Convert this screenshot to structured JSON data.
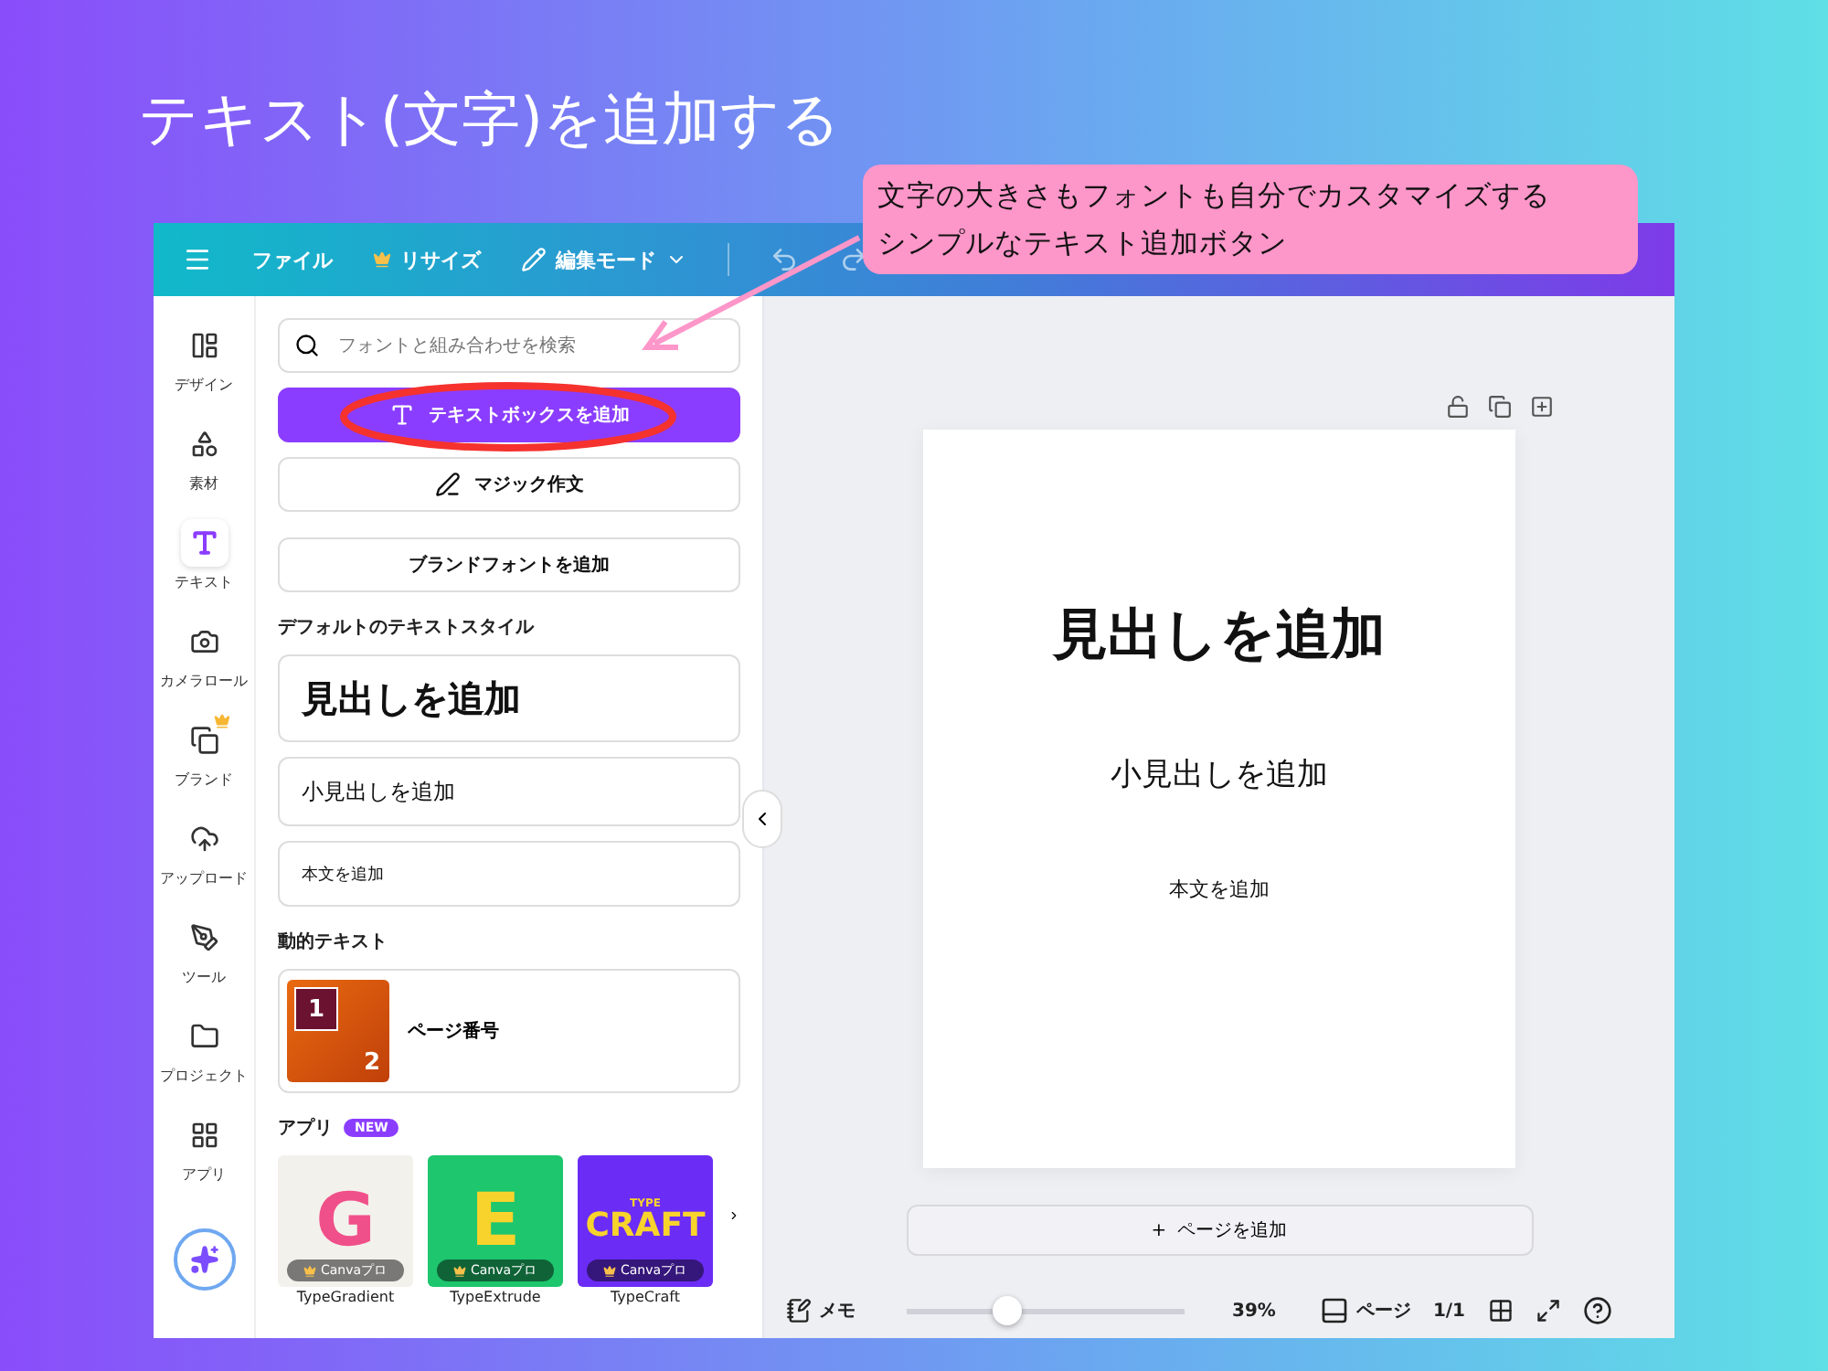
{
  "slide_title": "テキスト(文字)を追加する",
  "callout": {
    "lines": [
      "文字の大きさもフォントも自分でカスタマイズする",
      "シンプルなテキスト追加ボタン"
    ]
  },
  "topbar": {
    "menu": "ファイル",
    "resize": "リサイズ",
    "mode": "編集モード"
  },
  "sidebar": [
    {
      "kind": "design",
      "label": "デザイン",
      "selected": false,
      "premium": false
    },
    {
      "kind": "elements",
      "label": "素材",
      "selected": false,
      "premium": false
    },
    {
      "kind": "text",
      "label": "テキスト",
      "selected": true,
      "premium": false
    },
    {
      "kind": "camera",
      "label": "カメラロール",
      "selected": false,
      "premium": false
    },
    {
      "kind": "brand",
      "label": "ブランド",
      "selected": false,
      "premium": true
    },
    {
      "kind": "upload",
      "label": "アップロード",
      "selected": false,
      "premium": false
    },
    {
      "kind": "tools",
      "label": "ツール",
      "selected": false,
      "premium": false
    },
    {
      "kind": "projects",
      "label": "プロジェクト",
      "selected": false,
      "premium": false
    },
    {
      "kind": "apps",
      "label": "アプリ",
      "selected": false,
      "premium": false
    }
  ],
  "panel": {
    "search_placeholder": "フォントと組み合わせを検索",
    "add_textbox": "テキストボックスを追加",
    "magic_write": "マジック作文",
    "brand_fonts": "ブランドフォントを追加",
    "default_styles_heading": "デフォルトのテキストスタイル",
    "styles": [
      {
        "kind": "heading",
        "label": "見出しを追加"
      },
      {
        "kind": "subheading",
        "label": "小見出しを追加"
      },
      {
        "kind": "body",
        "label": "本文を追加"
      }
    ],
    "dynamic_heading": "動的テキスト",
    "page_number": {
      "label": "ページ番号",
      "thumb_numbers": [
        "1",
        "2"
      ]
    },
    "apps_heading": "アプリ",
    "apps_badge": "NEW",
    "apps": [
      {
        "kind": "gradient",
        "badge": "Canvaプロ",
        "name": "TypeGradient",
        "art": "G"
      },
      {
        "kind": "extrude",
        "badge": "Canvaプロ",
        "name": "TypeExtrude",
        "art": "E"
      },
      {
        "kind": "craft",
        "badge": "Canvaプロ",
        "name": "TypeCraft",
        "art": "CRAFT",
        "art_small": "TYPE"
      }
    ]
  },
  "canvas": {
    "page_texts": [
      {
        "kind": "heading",
        "text": "見出しを追加"
      },
      {
        "kind": "subheading",
        "text": "小見出しを追加"
      },
      {
        "kind": "body",
        "text": "本文を追加"
      }
    ],
    "add_page": "ページを追加",
    "add_page_icon": "+"
  },
  "bottombar": {
    "notes": "メモ",
    "zoom": {
      "level": 0.36,
      "reading": "39%"
    },
    "pages": "ページ",
    "page_count": "1/1"
  }
}
